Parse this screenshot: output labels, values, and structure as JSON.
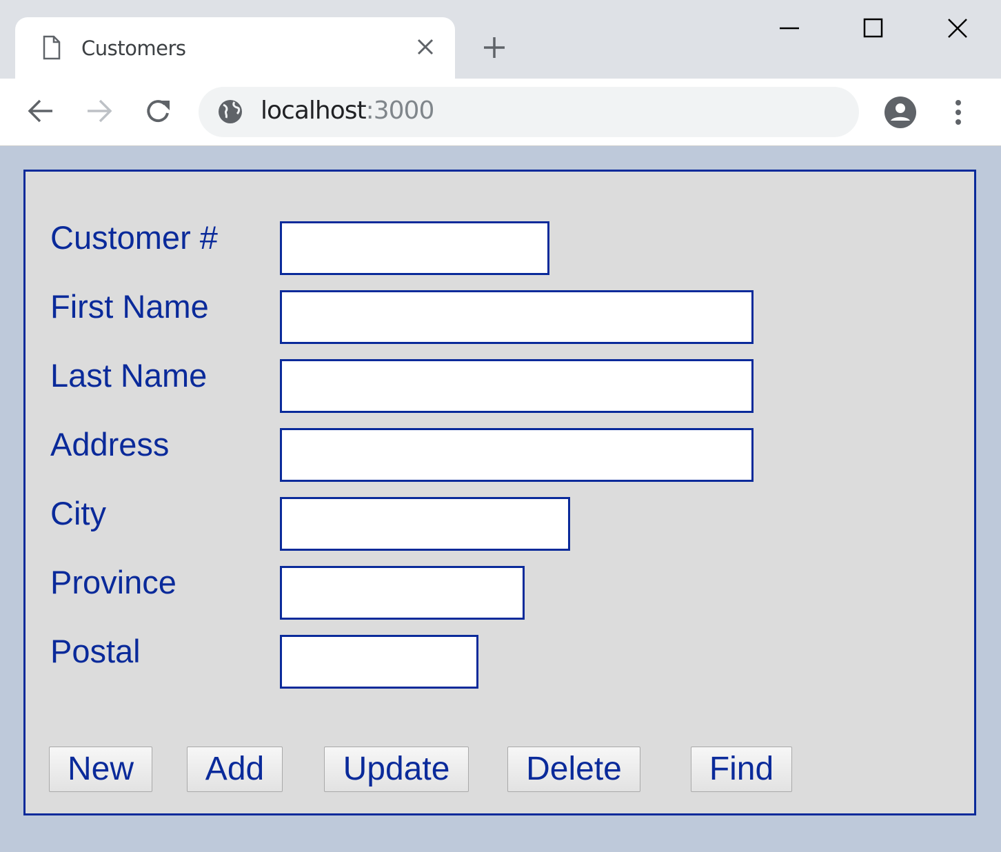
{
  "browser": {
    "tab_title": "Customers",
    "url_host": "localhost",
    "url_port": ":3000"
  },
  "form": {
    "fields": [
      {
        "label": "Customer #",
        "value": ""
      },
      {
        "label": "First Name",
        "value": ""
      },
      {
        "label": "Last Name",
        "value": ""
      },
      {
        "label": "Address",
        "value": ""
      },
      {
        "label": "City",
        "value": ""
      },
      {
        "label": "Province",
        "value": ""
      },
      {
        "label": "Postal",
        "value": ""
      }
    ],
    "buttons": {
      "new": "New",
      "add": "Add",
      "update": "Update",
      "delete": "Delete",
      "find": "Find"
    }
  },
  "colors": {
    "accent": "#0a2a9a",
    "page_bg": "#bec9da",
    "panel_bg": "#dcdcdc"
  }
}
